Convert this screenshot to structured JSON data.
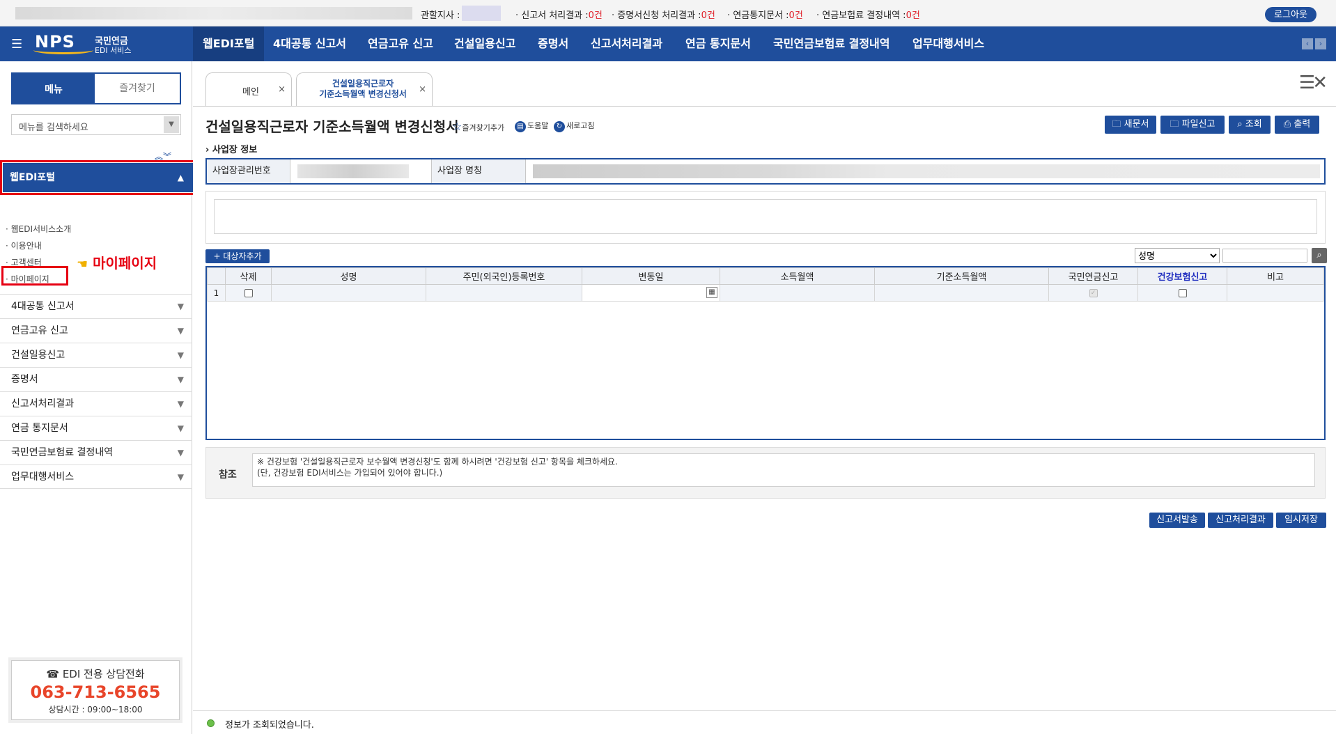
{
  "topbar": {
    "branch_label": "관할지사 :",
    "report_result_label": "· 신고서 처리결과 :",
    "report_result_count": "0건",
    "cert_result_label": "· 증명서신청 처리결과 :",
    "cert_result_count": "0건",
    "pension_notice_label": "· 연금통지문서 :",
    "pension_notice_count": "0건",
    "insurance_decision_label": "· 연금보험료 결정내역 :",
    "insurance_decision_count": "0건",
    "logout_label": "로그아웃"
  },
  "logo": {
    "brand": "NPS",
    "line1": "국민연금",
    "line2": "EDI 서비스"
  },
  "nav": {
    "items": [
      "웹EDI포털",
      "4대공통 신고서",
      "연금고유 신고",
      "건설일용신고",
      "증명서",
      "신고서처리결과",
      "연금 통지문서",
      "국민연금보험료 결정내역",
      "업무대행서비스"
    ],
    "prev": "‹",
    "next": "›"
  },
  "sidebar": {
    "tab_menu": "메뉴",
    "tab_favorites": "즐겨찾기",
    "search_placeholder": "메뉴를 검색하세요",
    "active_section": "웹EDI포털",
    "sub_items": [
      "· 웹EDI서비스소개",
      "· 이용안내",
      "· 고객센터",
      "· 마이페이지"
    ],
    "callout": "마이페이지",
    "sections": [
      "4대공통 신고서",
      "연금고유 신고",
      "건설일용신고",
      "증명서",
      "신고서처리결과",
      "연금 통지문서",
      "국민연금보험료 결정내역",
      "업무대행서비스"
    ],
    "phone_title": "☎ EDI 전용 상담전화",
    "phone_number": "063-713-6565",
    "phone_hours": "상담시간 : 09:00~18:00"
  },
  "tabs": {
    "main": "메인",
    "active_line1": "건설일용직근로자",
    "active_line2": "기준소득월액 변경신청서",
    "close": "×"
  },
  "page": {
    "title": "건설일용직근로자 기준소득월액 변경신청서",
    "favorite_add": "즐겨찾기추가",
    "help": "도움말",
    "refresh": "새로고침",
    "buttons": {
      "new_doc": "새문서",
      "file_report": "파일신고",
      "search": "조회",
      "print": "출력"
    }
  },
  "biz_info": {
    "section": "사업장 정보",
    "mgmt_no_label": "사업장관리번호",
    "name_label": "사업장 명칭"
  },
  "grid": {
    "add_target": "+ 대상자추가",
    "search_field": "성명",
    "headers": [
      "삭제",
      "성명",
      "주민(외국인)등록번호",
      "변동일",
      "소득월액",
      "기준소득월액",
      "국민연금신고",
      "건강보험신고",
      "비고"
    ],
    "row_no": "1"
  },
  "reference": {
    "label": "참조",
    "line1": "※ 건강보험 '건설일용직근로자 보수월액 변경신청'도 함께 하시려면 '건강보험 신고' 항목을 체크하세요.",
    "line2": "(단, 건강보험 EDI서비스는 가입되어 있어야 합니다.)"
  },
  "bottom_buttons": {
    "send": "신고서발송",
    "result": "신고처리결과",
    "temp_save": "임시저장"
  },
  "status": {
    "message": "정보가 조회되었습니다."
  },
  "colors": {
    "primary": "#1f4e9c",
    "highlight_red": "#e60012",
    "phone_orange": "#e8452a"
  }
}
